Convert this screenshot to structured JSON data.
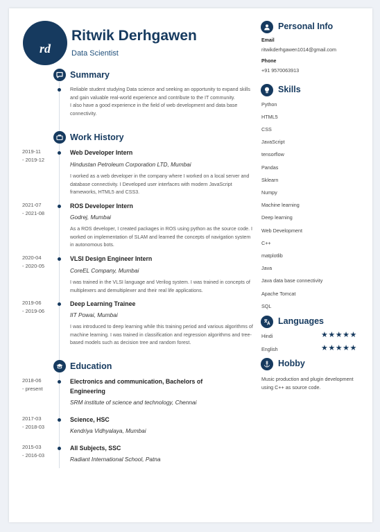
{
  "header": {
    "monogram": "rd",
    "name": "Ritwik Derhgawen",
    "job_title": "Data Scientist"
  },
  "summary": {
    "heading": "Summary",
    "lines": [
      "Reliable student studying Data science and seeking an opportunity to expand skills and gain valuable real-world experience and contribute to the IT community.",
      "I also have a good experience in the field of web development and data base connectivity."
    ]
  },
  "work": {
    "heading": "Work History",
    "items": [
      {
        "date_start": "2019-11",
        "date_end": "- 2019-12",
        "role": "Web Developer Intern",
        "org": "Hindustan Petroleum Corporation LTD, Mumbai",
        "desc": "I worked as a web developer in the company where I worked on a local server and database connectivity. I Developed user interfaces with modern JavaScript frameworks, HTML5 and CSS3."
      },
      {
        "date_start": "2021-07",
        "date_end": "- 2021-08",
        "role": "ROS Developer Intern",
        "org": "Godrej, Mumbai",
        "desc": "As a ROS  developer, I created packages in ROS using python as the source code. I worked on implementation of SLAM and learned the concepts of navigation system in autonomous bots."
      },
      {
        "date_start": "2020-04",
        "date_end": "- 2020-05",
        "role": "VLSI Design Engineer Intern",
        "org": "CoreEL Company, Mumbai",
        "desc": "I was trained in the VLSI language and Verilog system. I was trained in concepts of multiplexers and demultiplexer and their real life applications."
      },
      {
        "date_start": "2019-06",
        "date_end": "- 2019-06",
        "role": "Deep Learning Trainee",
        "org": "IIT Powai, Mumbai",
        "desc": "I was introduced to deep learning while this training period and various algorithms of machine learning. I was trained in classification and regression algorithms and tree-based models such as decision tree and random forest."
      }
    ]
  },
  "education": {
    "heading": "Education",
    "items": [
      {
        "date_start": "2018-06",
        "date_end": "- present",
        "degree": "Electronics and communication, Bachelors of Engineering",
        "school": "SRM institute of science and technology, Chennai"
      },
      {
        "date_start": "2017-03",
        "date_end": "- 2018-03",
        "degree": "Science, HSC",
        "school": "Kendriya Vidhyalaya, Mumbai"
      },
      {
        "date_start": "2015-03",
        "date_end": "- 2016-03",
        "degree": "All Subjects, SSC",
        "school": "Radiant International School, Patna"
      }
    ]
  },
  "personal": {
    "heading": "Personal Info",
    "email_label": "Email",
    "email": "ritwikderhgawen1014@gmail.com",
    "phone_label": "Phone",
    "phone": "+91 9570063913"
  },
  "skills": {
    "heading": "Skills",
    "items": [
      "Python",
      "HTML5",
      "CSS",
      "JavaScript",
      "tensorflow",
      "Pandas",
      "Sklearn",
      "Numpy",
      "Machine learning",
      "Deep learning",
      "Web Development",
      "C++",
      "matplotlib",
      "Java",
      "Java data base connectivity",
      "Apache Tomcat",
      "SQL"
    ]
  },
  "languages": {
    "heading": "Languages",
    "items": [
      {
        "name": "Hindi",
        "rating": 5,
        "max": 5
      },
      {
        "name": "English",
        "rating": 5,
        "max": 5
      }
    ]
  },
  "hobby": {
    "heading": "Hobby",
    "text": "Music production and plugin development using C++ as source code."
  },
  "icons": {
    "summary": "chat-bubble-icon",
    "work": "briefcase-icon",
    "education": "graduation-cap-icon",
    "personal": "person-icon",
    "skills": "lightbulb-icon",
    "languages": "translate-icon",
    "hobby": "anchor-icon"
  },
  "colors": {
    "accent": "#163a5f"
  }
}
